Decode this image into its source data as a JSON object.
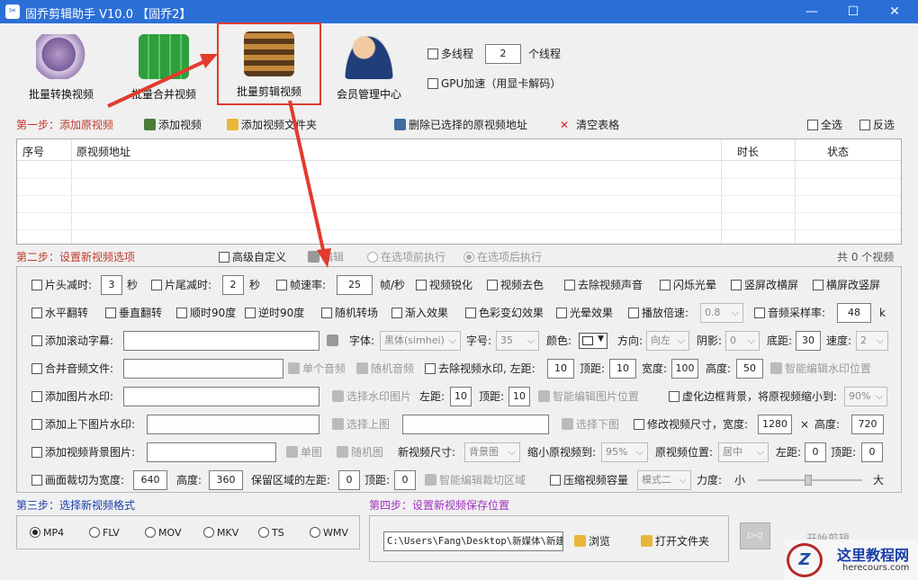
{
  "window": {
    "title": "固乔剪辑助手 V10.0  【固乔2】",
    "icon": "scissors-icon"
  },
  "toolbar": {
    "batch_convert": "批量转换视频",
    "batch_merge": "批量合并视频",
    "batch_edit": "批量剪辑视频",
    "member": "会员管理中心"
  },
  "options": {
    "multithread": "多线程",
    "threads": "2",
    "threads_unit": "个线程",
    "gpu": "GPU加速（用显卡解码）"
  },
  "step1": {
    "label": "第一步：添加原视频",
    "add_video": "添加视频",
    "add_folder": "添加视频文件夹",
    "delete_selected": "删除已选择的原视频地址",
    "clear_table": "清空表格",
    "select_all": "全选",
    "invert": "反选"
  },
  "table": {
    "col_index": "序号",
    "col_path": "原视频地址",
    "col_duration": "时长",
    "col_status": "状态"
  },
  "step2": {
    "label": "第二步：设置新视频选项",
    "advanced": "高级自定义",
    "edit": "编辑",
    "before": "在选项前执行",
    "after": "在选项后执行",
    "count": "共 0 个视频"
  },
  "r1": {
    "head_cut": "片头减时:",
    "head_val": "3",
    "sec1": "秒",
    "tail_cut": "片尾减时:",
    "tail_val": "2",
    "sec2": "秒",
    "fps": "帧速率:",
    "fps_val": "25",
    "fps_unit": "帧/秒",
    "sharpen": "视频锐化",
    "decolor": "视频去色",
    "mute": "去除视频声音",
    "flash": "闪烁光晕",
    "v2h": "竖屏改横屏",
    "h2v": "横屏改竖屏"
  },
  "r2": {
    "hflip": "水平翻转",
    "vflip": "垂直翻转",
    "rot90": "顺时90度",
    "rotn90": "逆时90度",
    "random_trans": "随机转场",
    "fade": "渐入效果",
    "color_fx": "色彩变幻效果",
    "glow": "光晕效果",
    "speed": "播放倍速:",
    "speed_val": "0.8",
    "samplerate": "音频采样率:",
    "sr_val": "48",
    "sr_unit": "k"
  },
  "r3": {
    "scroll_sub": "添加滚动字幕:",
    "font": "字体:",
    "font_val": "黑体(simhei)",
    "size": "字号:",
    "size_val": "35",
    "color": "颜色:",
    "direction": "方向:",
    "dir_val": "向左",
    "shadow": "阴影:",
    "shadow_val": "0",
    "bottom": "底距:",
    "bottom_val": "30",
    "speedl": "速度:",
    "speed_val": "2"
  },
  "r4": {
    "merge_audio": "合并音频文件:",
    "single_audio": "单个音频",
    "random_audio": "随机音频",
    "remove_wm": "去除视频水印, 左距:",
    "left_val": "10",
    "top": "顶距:",
    "top_val": "10",
    "width": "宽度:",
    "width_val": "100",
    "height": "高度:",
    "height_val": "50",
    "smart_wm": "智能编辑水印位置"
  },
  "r5": {
    "img_wm": "添加图片水印:",
    "choose_wm": "选择水印图片",
    "left": "左距:",
    "left_val": "10",
    "top": "顶距:",
    "top_val": "10",
    "smart_img": "智能编辑图片位置",
    "blur_bg": "虚化边框背景，将原视频缩小到:",
    "blur_val": "90%"
  },
  "r6": {
    "topbottom": "添加上下图片水印:",
    "choose_top": "选择上图",
    "choose_bottom": "选择下图",
    "resize": "修改视频尺寸，宽度:",
    "w_val": "1280",
    "x": "×",
    "h_label": "高度:",
    "h_val": "720"
  },
  "r7": {
    "bgimg": "添加视频背景图片:",
    "single_img": "单图",
    "random_img": "随机图",
    "new_size": "新视频尺寸:",
    "new_size_val": "背景图",
    "shrink": "缩小原视频到:",
    "shrink_val": "95%",
    "pos": "原视频位置:",
    "pos_val": "居中",
    "left": "左距:",
    "left_val": "0",
    "top": "顶距:",
    "top_val": "0"
  },
  "r8": {
    "crop": "画面裁切为宽度:",
    "crop_w": "640",
    "crop_h_label": "高度:",
    "crop_h": "360",
    "keep_left": "保留区域的左距:",
    "keep_left_val": "0",
    "keep_top": "顶距:",
    "keep_top_val": "0",
    "smart_crop": "智能编辑裁切区域",
    "compress": "压缩视频容量",
    "mode_val": "模式二",
    "strength": "力度:",
    "small": "小",
    "big": "大"
  },
  "step3": {
    "label": "第三步：选择新视频格式",
    "formats": [
      "MP4",
      "FLV",
      "MOV",
      "MKV",
      "TS",
      "WMV"
    ],
    "selected": "MP4"
  },
  "step4": {
    "label": "第四步：设置新视频保存位置",
    "path": "C:\\Users\\Fang\\Desktop\\新媒体\\新建",
    "browse": "浏览",
    "open_folder": "打开文件夹",
    "start": "开始剪辑"
  },
  "watermark": {
    "site": "这里教程网",
    "url": "herecours.com"
  },
  "colors": {
    "title_bar": "#2b6fd6",
    "highlight": "#e23b2e",
    "step1": "#c0392b",
    "step2": "#1a3ea8",
    "step4": "#a030c0"
  }
}
